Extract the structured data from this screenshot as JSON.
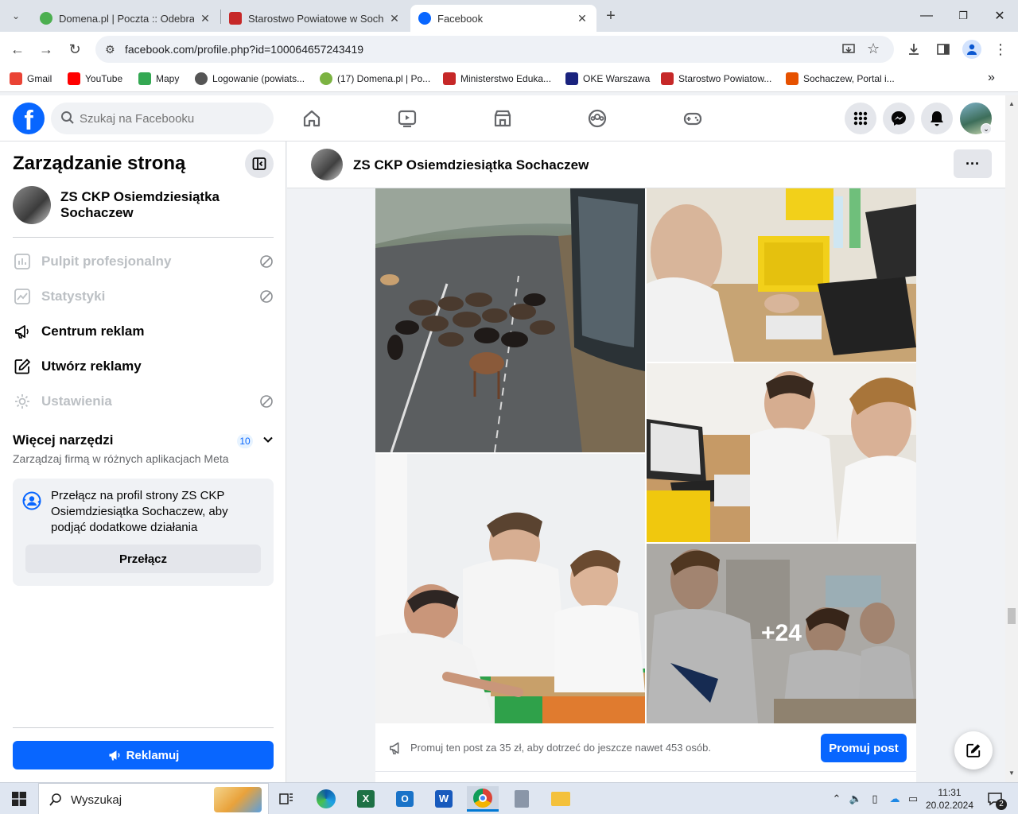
{
  "browser": {
    "tabs": [
      {
        "title": "Domena.pl | Poczta :: Odebrane",
        "favicon_color": "#4caf50"
      },
      {
        "title": "Starostwo Powiatowe w Sochaczewie",
        "favicon_color": "#c62828"
      },
      {
        "title": "Facebook",
        "favicon_color": "#0866ff"
      }
    ],
    "url": "facebook.com/profile.php?id=100064657243419",
    "bookmarks": [
      {
        "label": "Gmail",
        "color": "#ea4335"
      },
      {
        "label": "YouTube",
        "color": "#ff0000"
      },
      {
        "label": "Mapy",
        "color": "#34a853"
      },
      {
        "label": "Logowanie (powiats...",
        "color": "#555555"
      },
      {
        "label": "(17) Domena.pl | Po...",
        "color": "#7cb342"
      },
      {
        "label": "Ministerstwo Eduka...",
        "color": "#c62828"
      },
      {
        "label": "OKE Warszawa",
        "color": "#1a237e"
      },
      {
        "label": "Starostwo Powiatow...",
        "color": "#c62828"
      },
      {
        "label": "Sochaczew, Portal i...",
        "color": "#e65100"
      }
    ]
  },
  "fb": {
    "search_placeholder": "Szukaj na Facebooku",
    "brand_color": "#0866ff"
  },
  "sidebar": {
    "title": "Zarządzanie stroną",
    "page_name": "ZS CKP Osiemdziesiątka Sochaczew",
    "menu": [
      {
        "label": "Pulpit profesjonalny",
        "icon": "dashboard-icon",
        "disabled": true
      },
      {
        "label": "Statystyki",
        "icon": "insights-icon",
        "disabled": true
      },
      {
        "label": "Centrum reklam",
        "icon": "megaphone-icon",
        "disabled": false
      },
      {
        "label": "Utwórz reklamy",
        "icon": "edit-icon",
        "disabled": false
      },
      {
        "label": "Ustawienia",
        "icon": "gear-icon",
        "disabled": true
      }
    ],
    "more_tools": {
      "title": "Więcej narzędzi",
      "subtitle": "Zarządzaj firmą w różnych aplikacjach Meta",
      "badge": "10"
    },
    "switch_card": {
      "text": "Przełącz na profil strony ZS CKP Osiemdziesiątka Sochaczew, aby podjąć dodatkowe działania",
      "button": "Przełącz"
    },
    "promote_button": "Reklamuj"
  },
  "post": {
    "author": "ZS CKP Osiemdziesiątka Sochaczew",
    "more_photos": "+24",
    "promo_text": "Promuj ten post za 35 zł, aby dotrzeć do jeszcze nawet 453 osób.",
    "promo_button": "Promuj post"
  },
  "taskbar": {
    "search_label": "Wyszukaj",
    "time": "11:31",
    "date": "20.02.2024",
    "notification_count": "2"
  }
}
